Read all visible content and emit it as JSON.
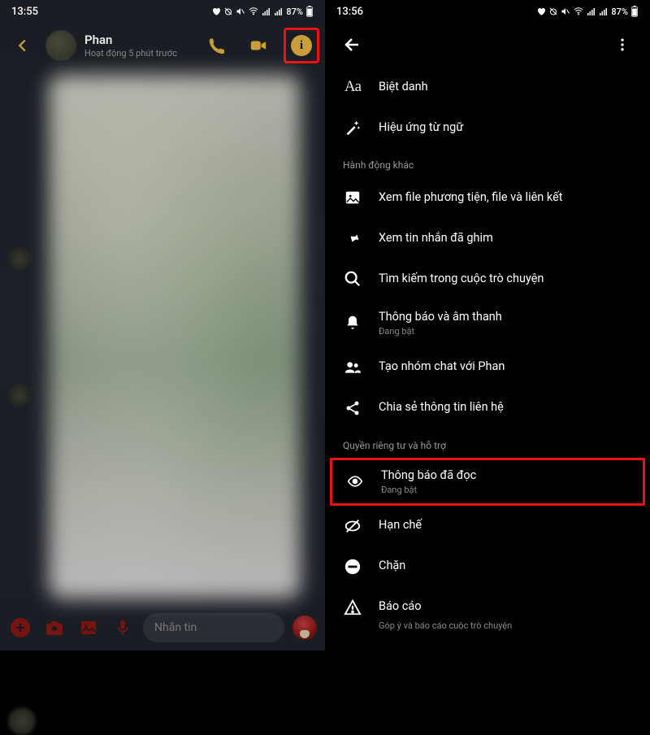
{
  "left": {
    "time": "13:55",
    "battery": "87%",
    "name": "Phan",
    "activity": "Hoạt động 5 phút trước",
    "composer_placeholder": "Nhắn tin"
  },
  "right": {
    "time": "13:56",
    "battery": "87%",
    "items": {
      "nickname": "Biệt danh",
      "word_effects": "Hiệu ứng từ ngữ"
    },
    "section_other": "Hành động khác",
    "other": {
      "media": "Xem file phương tiện, file và liên kết",
      "pinned": "Xem tin nhắn đã ghim",
      "search": "Tìm kiếm trong cuộc trò chuyện",
      "notif": "Thông báo và âm thanh",
      "notif_sub": "Đang bật",
      "group": "Tạo nhóm chat với Phan",
      "share": "Chia sẻ thông tin liên hệ"
    },
    "section_privacy": "Quyền riêng tư và hỗ trợ",
    "privacy": {
      "read": "Thông báo đã đọc",
      "read_sub": "Đang bật",
      "restrict": "Hạn chế",
      "block": "Chặn",
      "report": "Báo cáo",
      "report_sub": "Góp ý và báo cáo cuộc trò chuyện"
    }
  }
}
